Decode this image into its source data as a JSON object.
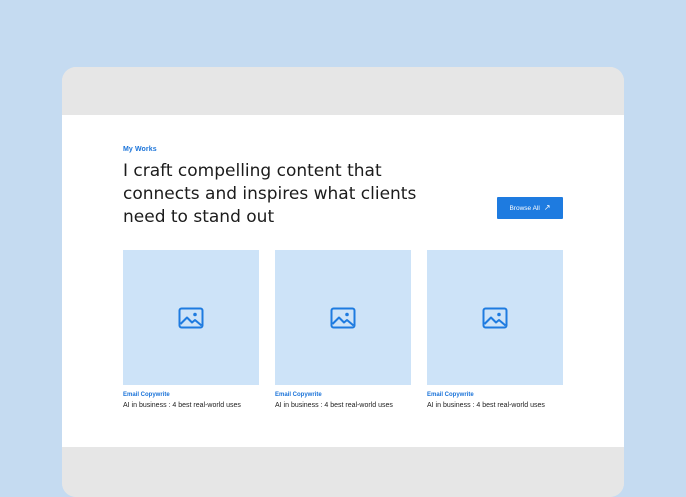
{
  "section": {
    "eyebrow": "My Works",
    "headline": "I craft compelling content that connects and inspires what clients need to stand out",
    "browse_label": "Browse All"
  },
  "cards": [
    {
      "category": "Email Copywrite",
      "title": "AI in business : 4 best real-world uses",
      "image_icon": "image-icon"
    },
    {
      "category": "Email Copywrite",
      "title": "AI in business : 4 best real-world uses",
      "image_icon": "image-icon"
    },
    {
      "category": "Email Copywrite",
      "title": "AI in business : 4 best real-world uses",
      "image_icon": "image-icon"
    }
  ],
  "colors": {
    "accent": "#1e7be0",
    "page_background": "#c5dbf1",
    "thumb_background": "#cde3f8"
  }
}
